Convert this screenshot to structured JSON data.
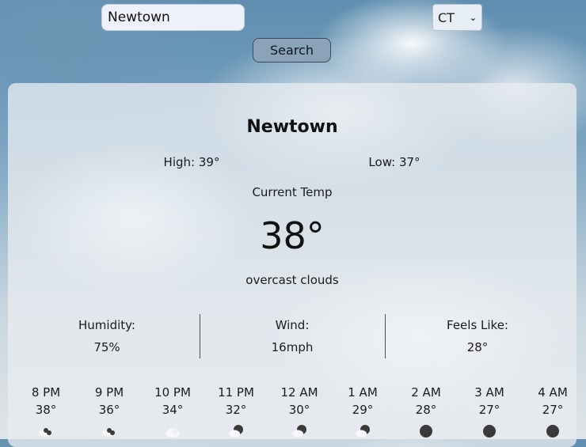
{
  "search": {
    "value": "Newtown",
    "button_label": "Search"
  },
  "state_select": {
    "selected": "CT",
    "chevron_icon": "chevron-down-icon"
  },
  "weather": {
    "city": "Newtown",
    "high": "High: 39°",
    "low": "Low: 37°",
    "current_label": "Current Temp",
    "current_temp": "38°",
    "description": "overcast clouds"
  },
  "stats": [
    {
      "label": "Humidity:",
      "value": "75%"
    },
    {
      "label": "Wind:",
      "value": "16mph"
    },
    {
      "label": "Feels Like:",
      "value": "28°"
    }
  ],
  "hourly": [
    {
      "time": "8 PM",
      "temp": "38°",
      "icon": "broken-clouds-night-icon"
    },
    {
      "time": "9 PM",
      "temp": "36°",
      "icon": "broken-clouds-night-icon"
    },
    {
      "time": "10 PM",
      "temp": "34°",
      "icon": "overcast-clouds-icon"
    },
    {
      "time": "11 PM",
      "temp": "32°",
      "icon": "partly-cloudy-night-icon"
    },
    {
      "time": "12 AM",
      "temp": "30°",
      "icon": "partly-cloudy-night-icon"
    },
    {
      "time": "1 AM",
      "temp": "29°",
      "icon": "partly-cloudy-night-icon"
    },
    {
      "time": "2 AM",
      "temp": "28°",
      "icon": "clear-night-icon"
    },
    {
      "time": "3 AM",
      "temp": "27°",
      "icon": "clear-night-icon"
    },
    {
      "time": "4 AM",
      "temp": "27°",
      "icon": "clear-night-icon"
    }
  ]
}
